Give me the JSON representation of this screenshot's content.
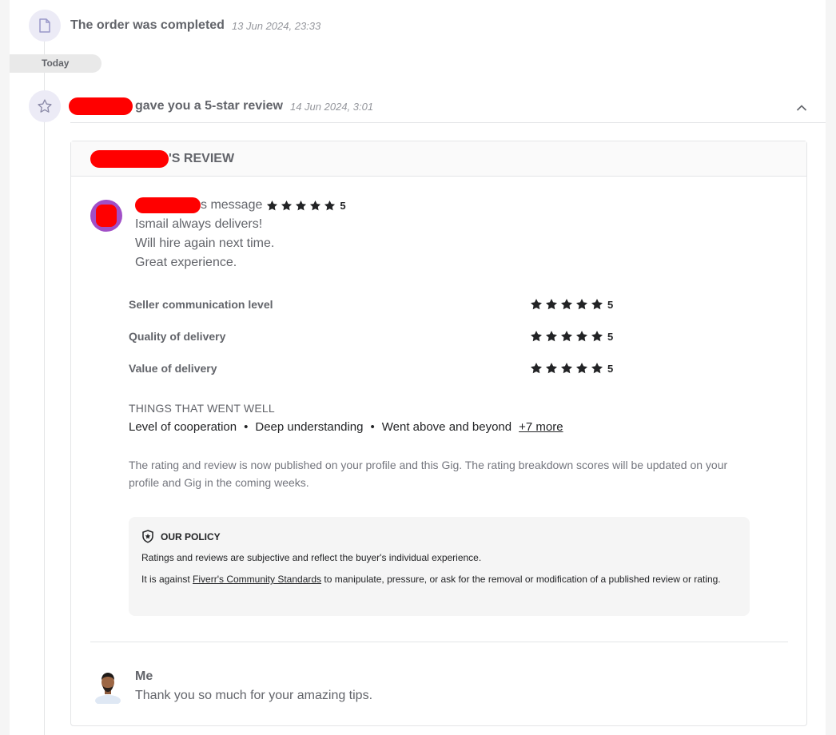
{
  "events": [
    {
      "title": "The order was completed",
      "time": "13 Jun 2024, 23:33",
      "icon": "document-icon"
    },
    {
      "title": "gave you a 5-star review",
      "time": "14 Jun 2024, 3:01",
      "icon": "star-outline-icon"
    }
  ],
  "day_separator": "Today",
  "review": {
    "header_suffix": "'S REVIEW",
    "message_label": "s message",
    "overall_rating": "5",
    "message_lines": [
      "Ismail always delivers!",
      "Will hire again next time.",
      "Great experience."
    ],
    "breakdown": [
      {
        "label": "Seller communication level",
        "rating": "5",
        "stars": 5
      },
      {
        "label": "Quality of delivery",
        "rating": "5",
        "stars": 5
      },
      {
        "label": "Value of delivery",
        "rating": "5",
        "stars": 5
      }
    ],
    "things_title": "THINGS THAT WENT WELL",
    "things": [
      "Level of cooperation",
      "Deep understanding",
      "Went above and beyond"
    ],
    "things_more": "+7 more",
    "publish_note": "The rating and review is now published on your profile and this Gig. The rating breakdown scores will be updated on your profile and Gig in the coming weeks.",
    "policy": {
      "title": "OUR POLICY",
      "p1": "Ratings and reviews are subjective and reflect the buyer's individual experience.",
      "p2_before": "It is against ",
      "p2_link": "Fiverr's Community Standards",
      "p2_after": " to manipulate, pressure, or ask for the removal or modification of a published review or rating."
    },
    "reply": {
      "name": "Me",
      "text": "Thank you so much for your amazing tips."
    }
  },
  "colors": {
    "accent_icon_bg": "#ecebf6",
    "redaction": "#ff0000",
    "star": "#222325",
    "avatar_ring": "#a14fc7"
  }
}
